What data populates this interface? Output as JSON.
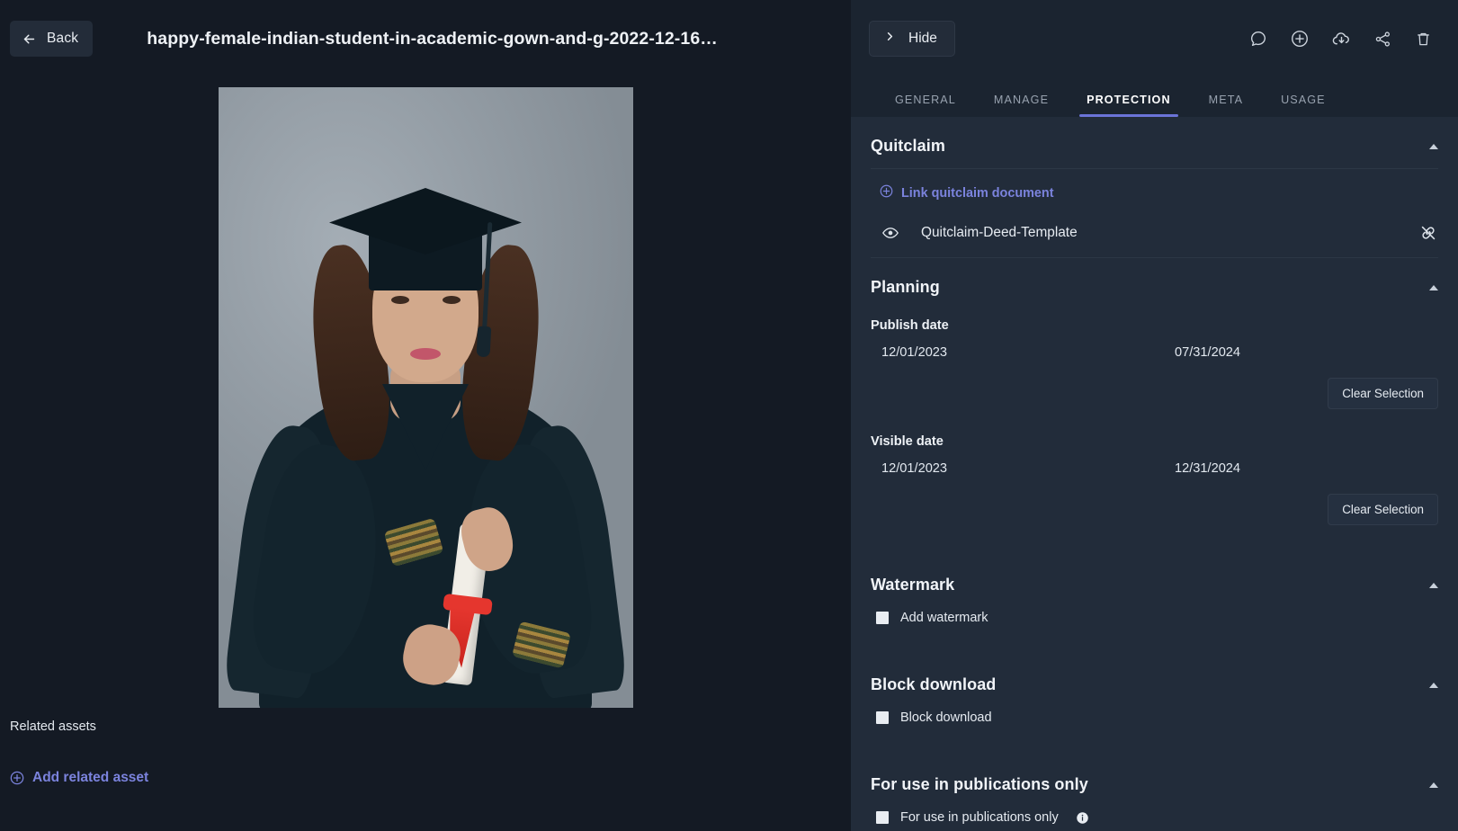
{
  "left": {
    "back_label": "Back",
    "asset_title": "happy-female-indian-student-in-academic-gown-and-g-2022-12-16-18...",
    "related_title": "Related assets",
    "add_related_label": "Add related asset"
  },
  "right": {
    "hide_label": "Hide",
    "topbar_icons": [
      {
        "name": "comment-icon"
      },
      {
        "name": "add-circle-icon"
      },
      {
        "name": "cloud-download-icon"
      },
      {
        "name": "share-icon"
      },
      {
        "name": "trash-icon"
      }
    ],
    "tabs": [
      {
        "label": "GENERAL",
        "active": false
      },
      {
        "label": "MANAGE",
        "active": false
      },
      {
        "label": "PROTECTION",
        "active": true
      },
      {
        "label": "META",
        "active": false
      },
      {
        "label": "USAGE",
        "active": false
      }
    ],
    "accent_color": "#6b74d8",
    "link_color": "#7b83dd",
    "sections": {
      "quitclaim": {
        "title": "Quitclaim",
        "link_label": "Link quitclaim document",
        "document_name": "Quitclaim-Deed-Template"
      },
      "planning": {
        "title": "Planning",
        "publish_label": "Publish date",
        "publish_from": "12/01/2023",
        "publish_to": "07/31/2024",
        "publish_clear_label": "Clear Selection",
        "visible_label": "Visible date",
        "visible_from": "12/01/2023",
        "visible_to": "12/31/2024",
        "visible_clear_label": "Clear Selection"
      },
      "watermark": {
        "title": "Watermark",
        "checkbox_label": "Add watermark",
        "checked": false
      },
      "block_download": {
        "title": "Block download",
        "checkbox_label": "Block download",
        "checked": false
      },
      "publications": {
        "title": "For use in publications only",
        "checkbox_label": "For use in publications only",
        "checked": false
      }
    }
  }
}
